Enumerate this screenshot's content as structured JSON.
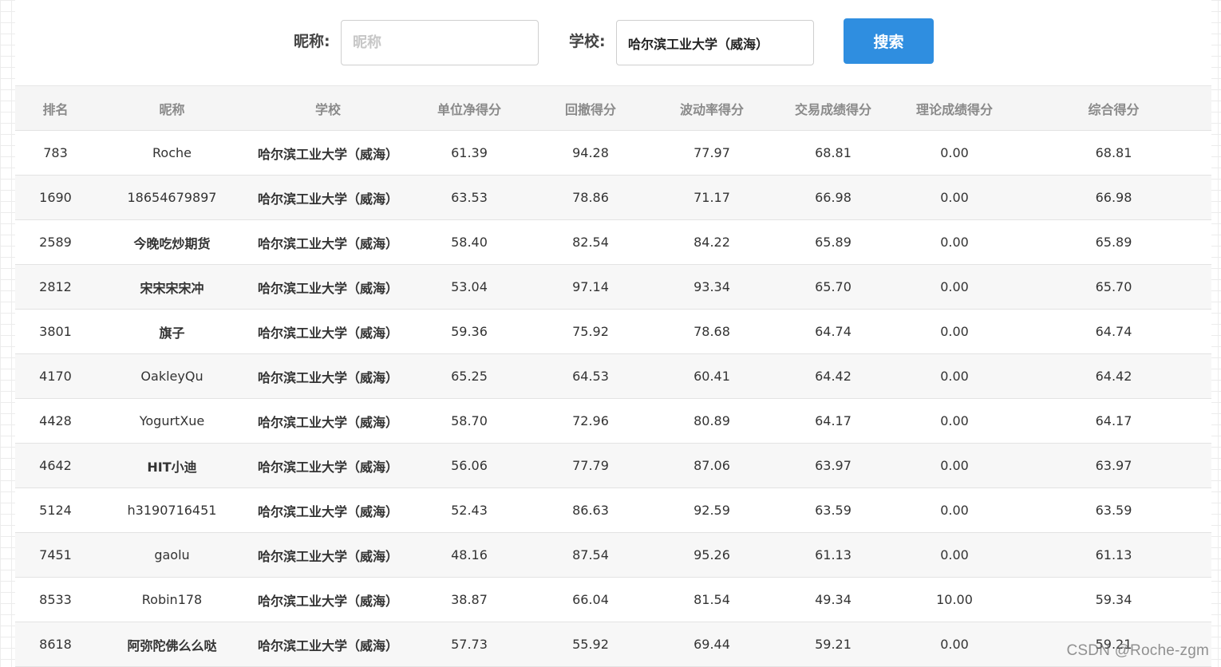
{
  "search": {
    "nickname_label": "昵称:",
    "nickname_placeholder": "昵称",
    "nickname_value": "",
    "school_label": "学校:",
    "school_value": "哈尔滨工业大学（威海）",
    "button_label": "搜索"
  },
  "table": {
    "headers": [
      "排名",
      "昵称",
      "学校",
      "单位净得分",
      "回撤得分",
      "波动率得分",
      "交易成绩得分",
      "理论成绩得分",
      "综合得分"
    ],
    "rows": [
      {
        "rank": "783",
        "nickname": "Roche",
        "school": "哈尔滨工业大学（威海）",
        "unit_net": "61.39",
        "drawdown": "94.28",
        "volatility": "77.97",
        "trading": "68.81",
        "theory": "0.00",
        "total": "68.81"
      },
      {
        "rank": "1690",
        "nickname": "18654679897",
        "school": "哈尔滨工业大学（威海）",
        "unit_net": "63.53",
        "drawdown": "78.86",
        "volatility": "71.17",
        "trading": "66.98",
        "theory": "0.00",
        "total": "66.98"
      },
      {
        "rank": "2589",
        "nickname": "今晚吃炒期货",
        "school": "哈尔滨工业大学（威海）",
        "unit_net": "58.40",
        "drawdown": "82.54",
        "volatility": "84.22",
        "trading": "65.89",
        "theory": "0.00",
        "total": "65.89"
      },
      {
        "rank": "2812",
        "nickname": "宋宋宋宋冲",
        "school": "哈尔滨工业大学（威海）",
        "unit_net": "53.04",
        "drawdown": "97.14",
        "volatility": "93.34",
        "trading": "65.70",
        "theory": "0.00",
        "total": "65.70"
      },
      {
        "rank": "3801",
        "nickname": "旗子",
        "school": "哈尔滨工业大学（威海）",
        "unit_net": "59.36",
        "drawdown": "75.92",
        "volatility": "78.68",
        "trading": "64.74",
        "theory": "0.00",
        "total": "64.74"
      },
      {
        "rank": "4170",
        "nickname": "OakleyQu",
        "school": "哈尔滨工业大学（威海）",
        "unit_net": "65.25",
        "drawdown": "64.53",
        "volatility": "60.41",
        "trading": "64.42",
        "theory": "0.00",
        "total": "64.42"
      },
      {
        "rank": "4428",
        "nickname": "YogurtXue",
        "school": "哈尔滨工业大学（威海）",
        "unit_net": "58.70",
        "drawdown": "72.96",
        "volatility": "80.89",
        "trading": "64.17",
        "theory": "0.00",
        "total": "64.17"
      },
      {
        "rank": "4642",
        "nickname": "HIT小迪",
        "school": "哈尔滨工业大学（威海）",
        "unit_net": "56.06",
        "drawdown": "77.79",
        "volatility": "87.06",
        "trading": "63.97",
        "theory": "0.00",
        "total": "63.97"
      },
      {
        "rank": "5124",
        "nickname": "h3190716451",
        "school": "哈尔滨工业大学（威海）",
        "unit_net": "52.43",
        "drawdown": "86.63",
        "volatility": "92.59",
        "trading": "63.59",
        "theory": "0.00",
        "total": "63.59"
      },
      {
        "rank": "7451",
        "nickname": "gaolu",
        "school": "哈尔滨工业大学（威海）",
        "unit_net": "48.16",
        "drawdown": "87.54",
        "volatility": "95.26",
        "trading": "61.13",
        "theory": "0.00",
        "total": "61.13"
      },
      {
        "rank": "8533",
        "nickname": "Robin178",
        "school": "哈尔滨工业大学（威海）",
        "unit_net": "38.87",
        "drawdown": "66.04",
        "volatility": "81.54",
        "trading": "49.34",
        "theory": "10.00",
        "total": "59.34"
      },
      {
        "rank": "8618",
        "nickname": "阿弥陀佛么么哒",
        "school": "哈尔滨工业大学（威海）",
        "unit_net": "57.73",
        "drawdown": "55.92",
        "volatility": "69.44",
        "trading": "59.21",
        "theory": "0.00",
        "total": "59.21"
      }
    ]
  },
  "watermark": "CSDN @Roche-zgm",
  "colors": {
    "button": "#2f8ee0",
    "header_bg": "#f5f5f5",
    "row_alt_bg": "#f7f7f7"
  }
}
